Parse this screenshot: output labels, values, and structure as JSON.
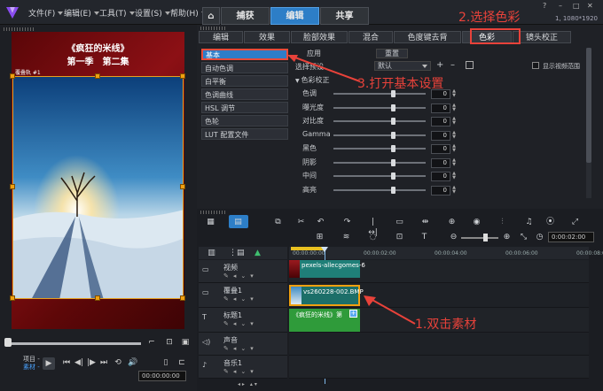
{
  "menu": {
    "items": [
      "文件(F)",
      "编辑(E)",
      "工具(T)",
      "设置(S)",
      "帮助(H)"
    ],
    "tabs": [
      {
        "label": "⌂",
        "active": false
      },
      {
        "label": "捕获",
        "active": false
      },
      {
        "label": "编辑",
        "active": true
      },
      {
        "label": "共享",
        "active": false
      }
    ],
    "resolution": "1, 1080*1920"
  },
  "preview": {
    "title_line1": "《疯狂的米线》",
    "title_line2": "第一季　第二集",
    "clip_label": "覆叠轨 #1",
    "mode_project": "项目 -",
    "mode_clip": "素材 -",
    "timecode": "00:00:00:00"
  },
  "subtabs": [
    "编辑",
    "效果",
    "脸部效果",
    "混合",
    "色度键去背",
    "色彩",
    "镜头校正"
  ],
  "active_subtab": 5,
  "color_list": [
    "基本",
    "自动色调",
    "白平衡",
    "色调曲线",
    "HSL 调节",
    "色轮",
    "LUT 配置文件"
  ],
  "active_list": 0,
  "settings": {
    "apply": "应用",
    "reset": "重置",
    "preset_label": "选择预设",
    "preset_value": "默认",
    "show_range": "显示视频范围",
    "section": "色彩校正",
    "sliders": [
      {
        "label": "色调",
        "value": 0
      },
      {
        "label": "曝光度",
        "value": 0
      },
      {
        "label": "对比度",
        "value": 0
      },
      {
        "label": "Gamma",
        "value": 0
      },
      {
        "label": "黑色",
        "value": 0
      },
      {
        "label": "阴影",
        "value": 0
      },
      {
        "label": "中间",
        "value": 0
      },
      {
        "label": "高亮",
        "value": 0
      }
    ]
  },
  "annotations": {
    "a1": "1.双击素材",
    "a2": "2.选择色彩",
    "a3": "3.打开基本设置"
  },
  "timeline": {
    "ruler": [
      "00:00:00:00",
      "00:00:02:00",
      "00:00:04:00",
      "00:00:06:00",
      "00:00:08:00"
    ],
    "timecode": "0:00:02:00",
    "tracks": [
      {
        "name": "视频",
        "clip": "pexels-allecgomes-6"
      },
      {
        "name": "覆叠1",
        "clip": "vs260228-002.BMP"
      },
      {
        "name": "标题1",
        "clip": "《疯狂的米线》第"
      },
      {
        "name": "声音",
        "clip": ""
      },
      {
        "name": "音乐1",
        "clip": ""
      }
    ]
  },
  "colors": {
    "accent": "#2d7ec7",
    "annotation": "#e8423a",
    "clip_teal": "#1f7f78",
    "clip_green": "#2f9b3a"
  }
}
